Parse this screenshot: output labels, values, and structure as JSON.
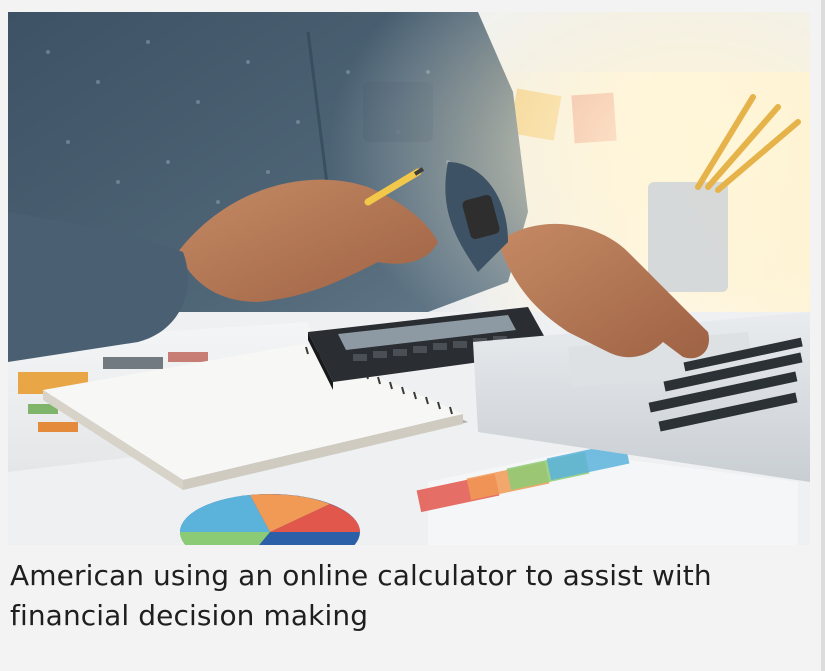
{
  "figure": {
    "image_icon": "photo-of-person-using-calculator-and-laptop",
    "caption": "American using an online calculator to assist with financial decision making"
  }
}
